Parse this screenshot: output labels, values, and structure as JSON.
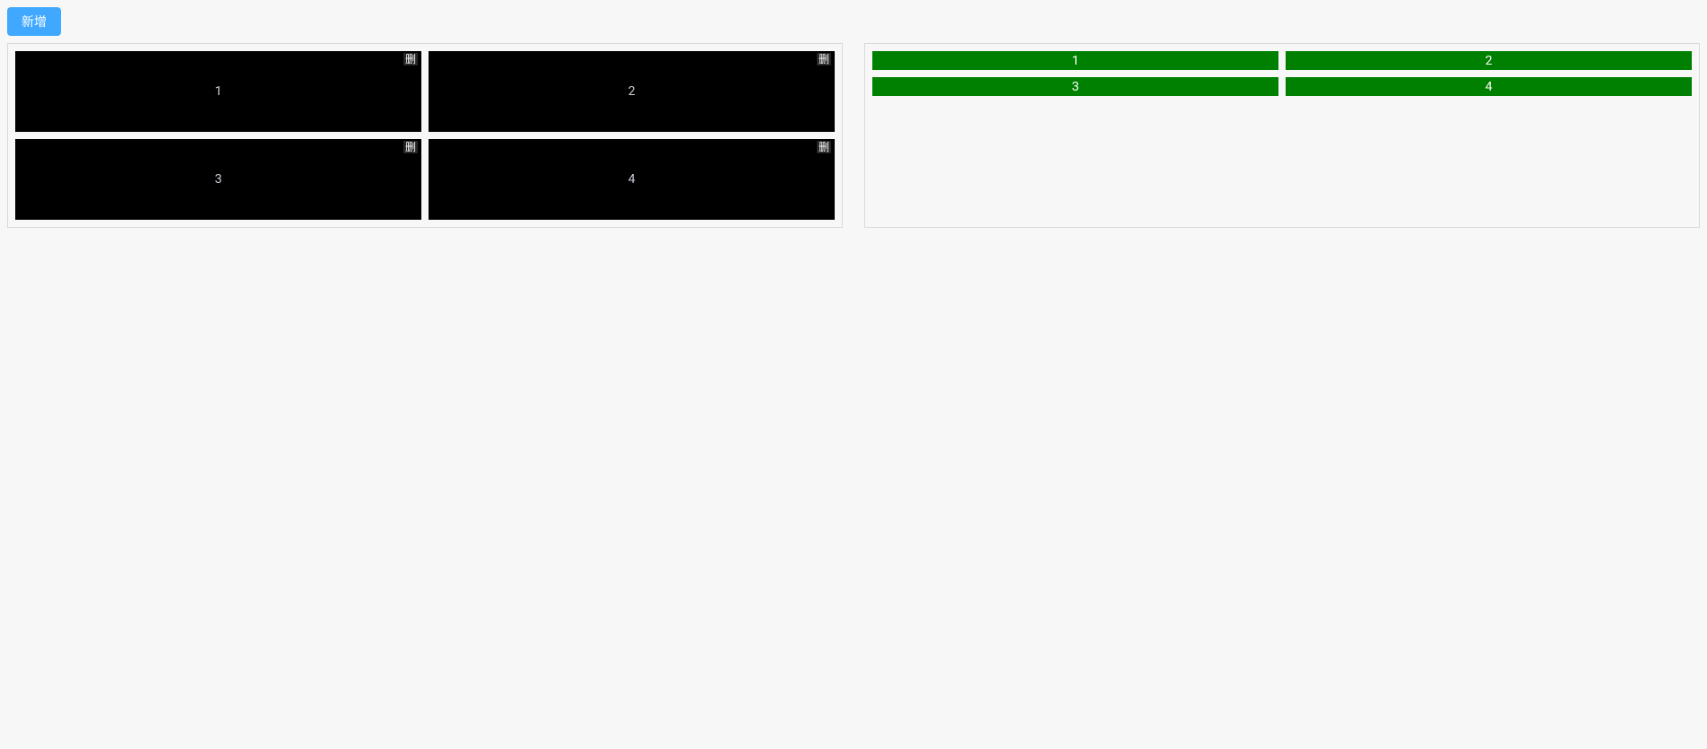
{
  "toolbar": {
    "add_label": "新增"
  },
  "leftPanel": {
    "cards": [
      {
        "id": "1",
        "label": "1",
        "delete_label": "删"
      },
      {
        "id": "2",
        "label": "2",
        "delete_label": "删"
      },
      {
        "id": "3",
        "label": "3",
        "delete_label": "删"
      },
      {
        "id": "4",
        "label": "4",
        "delete_label": "删"
      }
    ]
  },
  "rightPanel": {
    "cards": [
      {
        "id": "1",
        "label": "1"
      },
      {
        "id": "2",
        "label": "2"
      },
      {
        "id": "3",
        "label": "3"
      },
      {
        "id": "4",
        "label": "4"
      }
    ]
  }
}
